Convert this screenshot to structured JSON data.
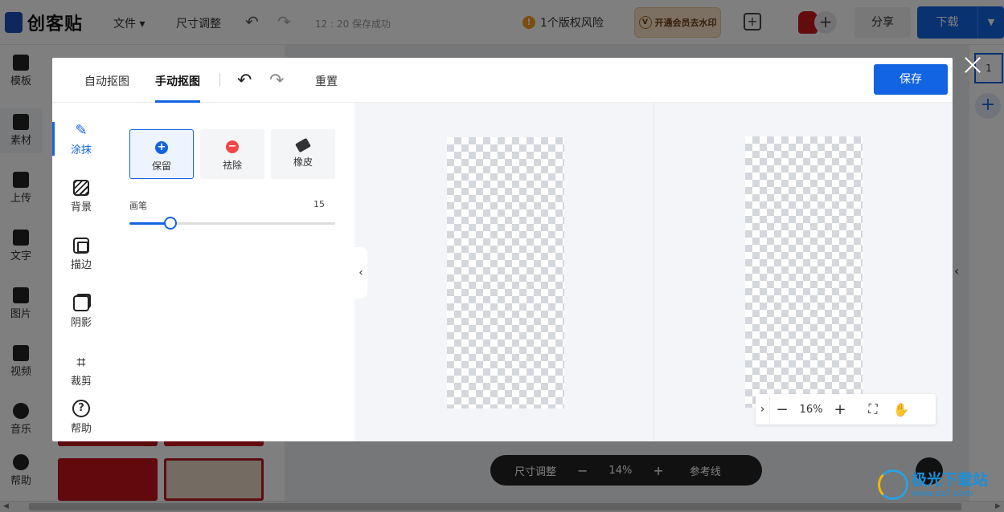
{
  "app": {
    "logo_text": "创客贴",
    "menu_file": "文件 ▾",
    "menu_resize": "尺寸调整",
    "autosave_status": "12 : 20 保存成功",
    "copyright_risk": "1个版权风险",
    "vip_label": "开通会员去水印",
    "share_label": "分享",
    "download_label": "下载",
    "page_number": "1",
    "sidebar": [
      "模板",
      "素材",
      "上传",
      "文字",
      "图片",
      "视频",
      "音乐",
      "帮助"
    ],
    "bottom_bar": {
      "resize": "尺寸调整",
      "zoom": "14%",
      "guides": "参考线"
    },
    "watermark": {
      "name": "极光下载站",
      "url": "www.xz7.com"
    }
  },
  "modal": {
    "tabs": [
      {
        "label": "自动抠图"
      },
      {
        "label": "手动抠图"
      }
    ],
    "active_tab": "手动抠图",
    "reset_label": "重置",
    "save_label": "保存",
    "tools": [
      {
        "label": "涂抹",
        "icon": "brush-icon"
      },
      {
        "label": "背景",
        "icon": "background-icon"
      },
      {
        "label": "描边",
        "icon": "stroke-icon"
      },
      {
        "label": "阴影",
        "icon": "shadow-icon"
      },
      {
        "label": "裁剪",
        "icon": "crop-icon"
      },
      {
        "label": "帮助",
        "icon": "help-icon"
      }
    ],
    "active_tool": "涂抹",
    "brush_modes": [
      {
        "label": "保留",
        "icon": "keep-icon"
      },
      {
        "label": "祛除",
        "icon": "remove-icon"
      },
      {
        "label": "橡皮",
        "icon": "eraser-icon"
      }
    ],
    "selected_mode": "保留",
    "brush": {
      "label": "画笔",
      "value": "15",
      "fraction": 0.2
    },
    "zoom": {
      "value": "16%"
    }
  },
  "colors": {
    "accent": "#1264e3",
    "danger": "#f04747",
    "warning": "#f59a23"
  }
}
